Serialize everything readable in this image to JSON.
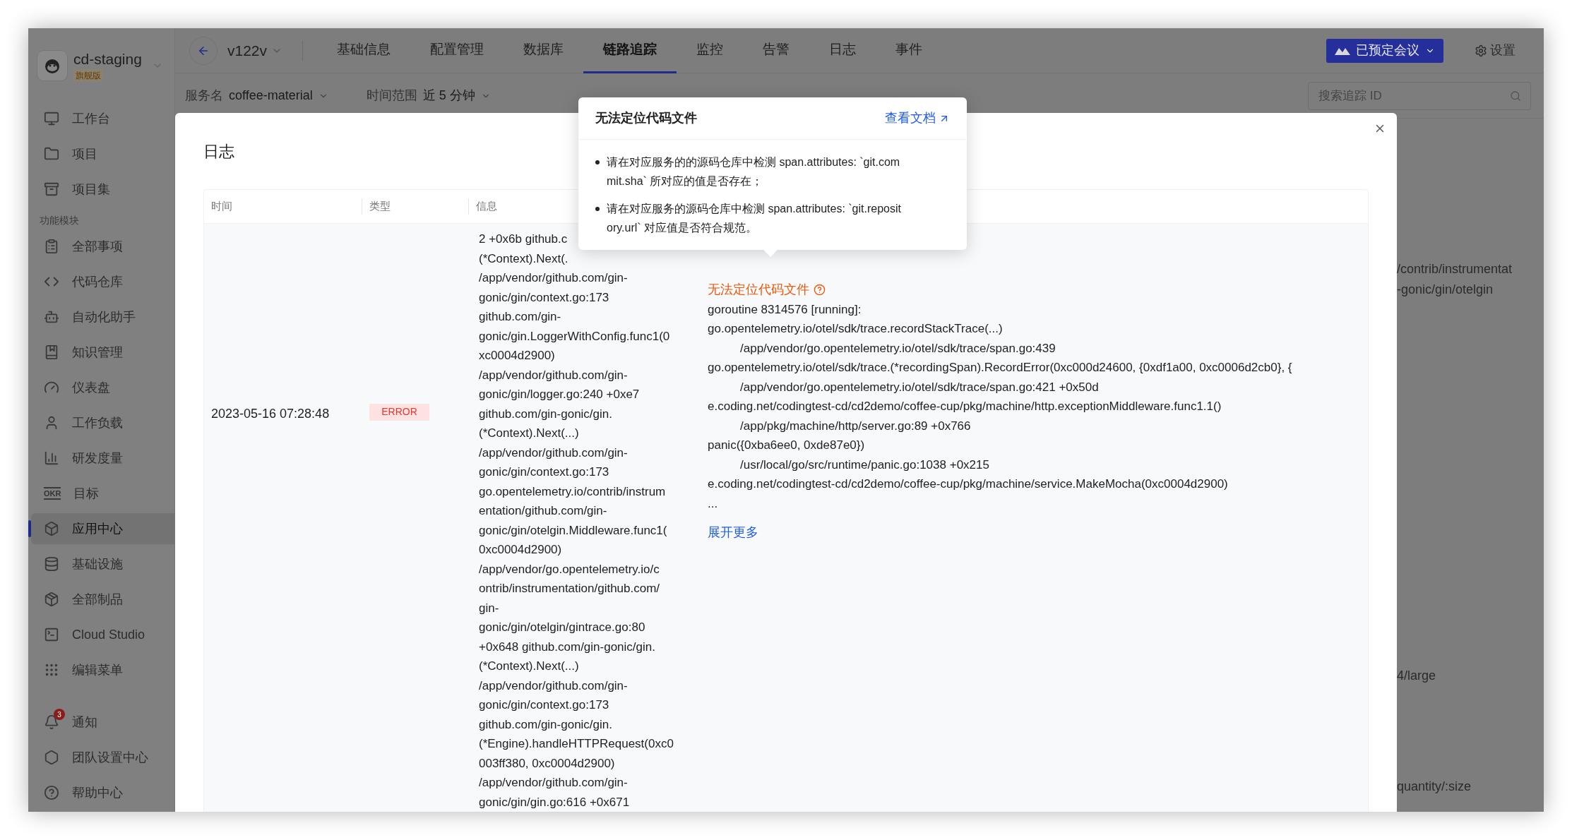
{
  "sidebar": {
    "workspace": "cd-staging",
    "plan": "旗舰版",
    "top_items": [
      {
        "label": "工作台",
        "selected": false
      },
      {
        "label": "项目",
        "selected": false
      },
      {
        "label": "项目集",
        "selected": false
      }
    ],
    "section_label": "功能模块",
    "module_items": [
      {
        "label": "全部事项",
        "selected": false
      },
      {
        "label": "代码仓库",
        "selected": false
      },
      {
        "label": "自动化助手",
        "selected": false
      },
      {
        "label": "知识管理",
        "selected": false
      },
      {
        "label": "仪表盘",
        "selected": false
      },
      {
        "label": "工作负载",
        "selected": false
      },
      {
        "label": "研发度量",
        "selected": false
      },
      {
        "label": "目标",
        "icon_text": "OKR",
        "selected": false
      },
      {
        "label": "应用中心",
        "selected": true
      },
      {
        "label": "基础设施",
        "selected": false
      },
      {
        "label": "全部制品",
        "selected": false
      },
      {
        "label": "Cloud Studio",
        "selected": false
      },
      {
        "label": "编辑菜单",
        "selected": false
      }
    ],
    "bottom_items": [
      {
        "label": "通知",
        "badge": "3",
        "selected": false
      },
      {
        "label": "团队设置中心",
        "selected": false
      },
      {
        "label": "帮助中心",
        "selected": false
      }
    ]
  },
  "topbar": {
    "version": "v122v",
    "tabs": [
      {
        "label": "基础信息",
        "selected": false
      },
      {
        "label": "配置管理",
        "selected": false
      },
      {
        "label": "数据库",
        "selected": false
      },
      {
        "label": "链路追踪",
        "selected": true
      },
      {
        "label": "监控",
        "selected": false
      },
      {
        "label": "告警",
        "selected": false
      },
      {
        "label": "日志",
        "selected": false
      },
      {
        "label": "事件",
        "selected": false
      }
    ],
    "meeting_button": "已预定会议",
    "settings": "设置"
  },
  "filters": [
    {
      "label": "服务名",
      "value": "coffee-material"
    },
    {
      "label": "时间范围",
      "value": "近 5 分钟"
    }
  ],
  "search": {
    "placeholder": "搜索追踪 ID"
  },
  "background_text": [
    "/contrib/instrumentat",
    "-gonic/gin/otelgin",
    "4/large",
    "quantity/:size"
  ],
  "modal": {
    "title": "日志",
    "columns": [
      "时间",
      "类型",
      "信息"
    ],
    "row": {
      "time": "2023-05-16 07:28:48",
      "type": "ERROR",
      "info_lines": [
        "2 +0x6b github.c",
        "(*Context).Next(.",
        "/app/vendor/github.com/gin-",
        "gonic/gin/context.go:173",
        "github.com/gin-",
        "gonic/gin.LoggerWithConfig.func1(0",
        "xc0004d2900)",
        "/app/vendor/github.com/gin-",
        "gonic/gin/logger.go:240 +0xe7",
        "github.com/gin-gonic/gin.",
        "(*Context).Next(...)",
        "/app/vendor/github.com/gin-",
        "gonic/gin/context.go:173",
        "go.opentelemetry.io/contrib/instrum",
        "entation/github.com/gin-",
        "gonic/gin/otelgin.Middleware.func1(",
        "0xc0004d2900)",
        "/app/vendor/go.opentelemetry.io/c",
        "ontrib/instrumentation/github.com/",
        "gin-",
        "gonic/gin/otelgin/gintrace.go:80",
        "+0x648 github.com/gin-gonic/gin.",
        "(*Context).Next(...)",
        "/app/vendor/github.com/gin-",
        "gonic/gin/context.go:173",
        "github.com/gin-gonic/gin.",
        "(*Engine).handleHTTPRequest(0xc0",
        "003ff380, 0xc0004d2900)",
        "/app/vendor/github.com/gin-",
        "gonic/gin/gin.go:616 +0x671"
      ],
      "detail": {
        "warning": "无法定位代码文件",
        "lines": [
          {
            "text": "goroutine 8314576 [running]:",
            "indent": false
          },
          {
            "text": "go.opentelemetry.io/otel/sdk/trace.recordStackTrace(...)",
            "indent": false
          },
          {
            "text": "/app/vendor/go.opentelemetry.io/otel/sdk/trace/span.go:439",
            "indent": true
          },
          {
            "text": "go.opentelemetry.io/otel/sdk/trace.(*recordingSpan).RecordError(0xc000d24600, {0xdf1a00, 0xc0006d2cb0}, {",
            "indent": false
          },
          {
            "text": "/app/vendor/go.opentelemetry.io/otel/sdk/trace/span.go:421 +0x50d",
            "indent": true
          },
          {
            "text": "e.coding.net/codingtest-cd/cd2demo/coffee-cup/pkg/machine/http.exceptionMiddleware.func1.1()",
            "indent": false
          },
          {
            "text": "/app/pkg/machine/http/server.go:89 +0x766",
            "indent": true
          },
          {
            "text": "panic({0xba6ee0, 0xde87e0})",
            "indent": false
          },
          {
            "text": "/usr/local/go/src/runtime/panic.go:1038 +0x215",
            "indent": true
          },
          {
            "text": "e.coding.net/codingtest-cd/cd2demo/coffee-cup/pkg/machine/service.MakeMocha(0xc0004d2900)",
            "indent": false
          }
        ],
        "ellipsis": "...",
        "more_link": "展开更多"
      }
    }
  },
  "popover": {
    "title": "无法定位代码文件",
    "link": "查看文档",
    "bullets": [
      "请在对应服务的的源码仓库中检测 span.attributes: `git.commit.sha` 所对应的值是否存在；",
      "请在对应服务的源码仓库中检测 span.attributes: `git.repository.url` 对应值是否符合规范。"
    ]
  }
}
